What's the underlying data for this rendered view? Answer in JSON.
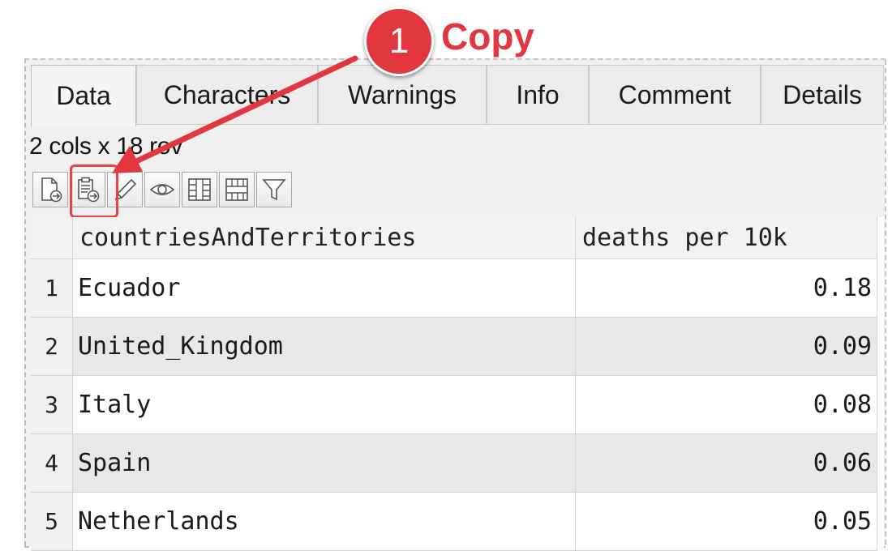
{
  "tabs": [
    {
      "label": "Data",
      "active": true
    },
    {
      "label": "Characters",
      "active": false
    },
    {
      "label": "Warnings",
      "active": false
    },
    {
      "label": "Info",
      "active": false
    },
    {
      "label": "Comment",
      "active": false
    },
    {
      "label": "Details",
      "active": false
    }
  ],
  "info_text": "2 cols x 18 rov",
  "toolbar": {
    "icons": [
      "export-file-icon",
      "copy-clipboard-icon",
      "edit-pencil-icon",
      "view-eye-icon",
      "columns-icon",
      "rows-icon",
      "filter-icon"
    ]
  },
  "table": {
    "columns": [
      "countriesAndTerritories",
      "deaths per 10k"
    ],
    "rows": [
      {
        "num": "1",
        "country": "Ecuador",
        "deaths": "0.18"
      },
      {
        "num": "2",
        "country": "United_Kingdom",
        "deaths": "0.09"
      },
      {
        "num": "3",
        "country": "Italy",
        "deaths": "0.08"
      },
      {
        "num": "4",
        "country": "Spain",
        "deaths": "0.06"
      },
      {
        "num": "5",
        "country": "Netherlands",
        "deaths": "0.05"
      }
    ]
  },
  "callout": {
    "number": "1",
    "label": "Copy",
    "color": "#e2373f"
  }
}
